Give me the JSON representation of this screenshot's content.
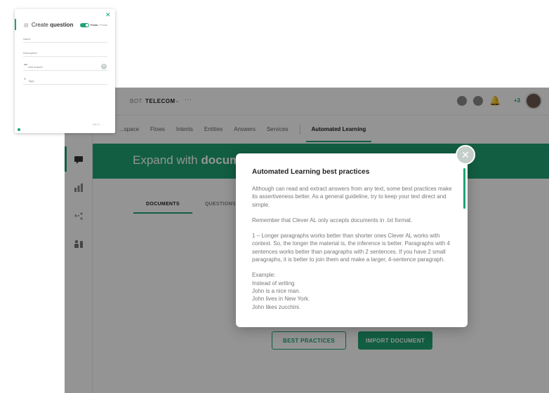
{
  "panel": {
    "title_prefix": "Create",
    "title_bold": "question",
    "public_label": "Public",
    "private_label": "Private",
    "name_placeholder": "Name",
    "description_placeholder": "Description",
    "answer_placeholder": "Add answer",
    "tags_placeholder": "Tags",
    "next_label": "NEXT",
    "next_arrow": "→",
    "close_glyph": "✕"
  },
  "topbar": {
    "bot_label": "BOT",
    "bot_name": "TELECOM",
    "caret": "⌄",
    "more": "···",
    "notification_count": "+3"
  },
  "nav": {
    "tabs": [
      "...space",
      "Flows",
      "Intents",
      "Entities",
      "Answers",
      "Services"
    ],
    "active_tab": "Automated Learning"
  },
  "banner": {
    "title_light": "Expand with ",
    "title_bold": "docum"
  },
  "subtabs": {
    "documents": "DOCUMENTS",
    "questions": "QUESTIONS"
  },
  "actions": {
    "best_practices": "BEST PRACTICES",
    "import_document": "IMPORT DOCUMENT"
  },
  "modal": {
    "title": "Automated Learning best practices",
    "p1": "Although can read and extract answers from any text, some best practices make its assertiveness better. As a general guideline, try to keep your text direct and simple.",
    "p2": "Remember that Clever AL only accepts documents in .txt format.",
    "p3": "1 – Longer paragraphs works better than shorter ones Clever AL works with context. So, the longer the material is, the inference is better. Paragraphs with 4 sentences works better than paragraphs with 2 sentences. If you have 2 small paragraphs, it is better to join them and make a larger, 4-sentence paragraph.",
    "example_lines": [
      "Example:",
      "Instead of writing",
      "John is a nice man.",
      "John lives in New York.",
      "John likes zucchini."
    ],
    "close_glyph": "✕"
  },
  "colors": {
    "accent": "#1fa372",
    "overlay": "rgba(0,0,0,0.42)"
  }
}
